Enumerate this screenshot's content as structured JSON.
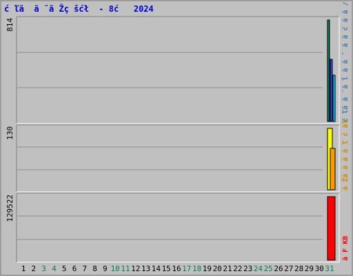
{
  "chart_data": {
    "type": "bar",
    "title": "ć ľă  ă ¨ă Žç šćł  - 8ć   2024",
    "x": [
      "1",
      "2",
      "3",
      "4",
      "5",
      "6",
      "7",
      "8",
      "9",
      "10",
      "11",
      "12",
      "13",
      "14",
      "15",
      "16",
      "17",
      "18",
      "19",
      "20",
      "21",
      "22",
      "23",
      "24",
      "25",
      "26",
      "27",
      "28",
      "29",
      "30",
      "31"
    ],
    "x_colors": [
      "#000000",
      "#000000",
      "#007f60",
      "#007f60",
      "#000000",
      "#000000",
      "#000000",
      "#000000",
      "#000000",
      "#007f60",
      "#007f60",
      "#000000",
      "#000000",
      "#000000",
      "#000000",
      "#000000",
      "#007f60",
      "#007f60",
      "#000000",
      "#000000",
      "#000000",
      "#000000",
      "#000000",
      "#007f60",
      "#007f60",
      "#000000",
      "#000000",
      "#000000",
      "#000000",
      "#000000",
      "#007f60"
    ],
    "grid": true,
    "panels": [
      {
        "ymax_label": "814",
        "ymax": 814,
        "series": [
          {
            "color": "#1a7a5e",
            "value": 814
          },
          {
            "color": "#2050ff",
            "value": 500
          },
          {
            "color": "#00ccff",
            "value": 370
          }
        ],
        "side_label": "ć ľă  ă ¨ă ĺ ă ă ˇ ă ă ć ä ă  / ă ¨ă ă ă ",
        "side_label_color": "#4a7ab0"
      },
      {
        "ymax_label": "130",
        "ymax": 130,
        "series": [
          {
            "color": "#ffff00",
            "value": 130
          },
          {
            "color": "#ff9900",
            "value": 88
          }
        ],
        "side_label": "ă Žă ă ă ă ľ ć äľ",
        "side_label_color": "#d08a00"
      },
      {
        "ymax_label": "129522",
        "ymax": 129522,
        "series": [
          {
            "color": "#ff0000",
            "value": 129522
          }
        ],
        "side_label": "ă F KB",
        "side_label_color": "#ff0000"
      }
    ]
  }
}
